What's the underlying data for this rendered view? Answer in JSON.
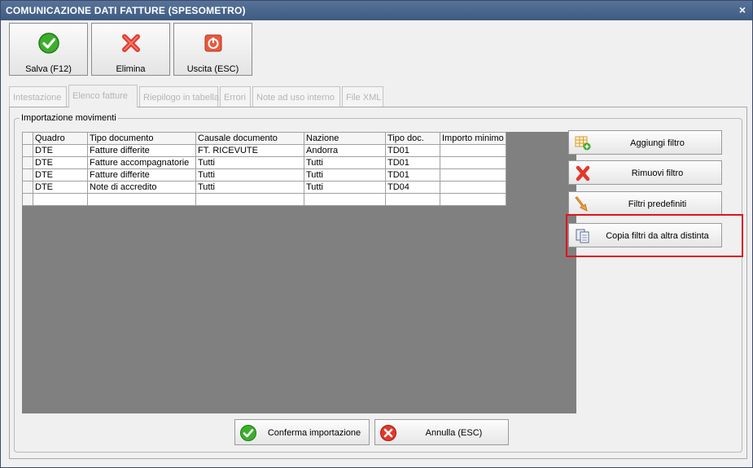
{
  "window": {
    "title": "COMUNICAZIONE DATI FATTURE (SPESOMETRO)",
    "close_glyph": "×"
  },
  "toolbar": {
    "save_label": "Salva (F12)",
    "delete_label": "Elimina",
    "exit_label": "Uscita (ESC)"
  },
  "tabs": [
    {
      "label": "Intestazione",
      "active": false
    },
    {
      "label": "Elenco fatture",
      "active": true
    },
    {
      "label": "Riepilogo in tabella",
      "active": false
    },
    {
      "label": "Errori",
      "active": false
    },
    {
      "label": "Note ad uso interno",
      "active": false
    },
    {
      "label": "File XML",
      "active": false
    }
  ],
  "group": {
    "legend": "Importazione movimenti"
  },
  "grid": {
    "columns": [
      "Quadro",
      "Tipo documento",
      "Causale documento",
      "Nazione",
      "Tipo doc.",
      "Importo minimo"
    ],
    "rows": [
      [
        "DTE",
        "Fatture differite",
        "FT. RICEVUTE",
        "Andorra",
        "TD01",
        ""
      ],
      [
        "DTE",
        "Fatture accompagnatorie",
        "Tutti",
        "Tutti",
        "TD01",
        ""
      ],
      [
        "DTE",
        "Fatture differite",
        "Tutti",
        "Tutti",
        "TD01",
        ""
      ],
      [
        "DTE",
        "Note di accredito",
        "Tutti",
        "Tutti",
        "TD04",
        ""
      ],
      [
        "",
        "",
        "",
        "",
        "",
        ""
      ]
    ]
  },
  "side_buttons": {
    "add_filter": "Aggiungi filtro",
    "remove_filter": "Rimuovi filtro",
    "predefined_filters": "Filtri predefiniti",
    "copy_filters": "Copia filtri da altra distinta"
  },
  "bottom_buttons": {
    "confirm": "Conferma importazione",
    "cancel": "Annulla (ESC)"
  },
  "icons": {
    "save": "check-circle-icon",
    "delete": "red-x-icon",
    "exit": "power-icon",
    "add_filter": "grid-add-icon",
    "remove_filter": "red-x-icon",
    "predefined": "filter-arrow-icon",
    "copy": "copy-pages-icon"
  },
  "colors": {
    "highlight": "#e0141d",
    "titlebar": "#4a6690"
  }
}
